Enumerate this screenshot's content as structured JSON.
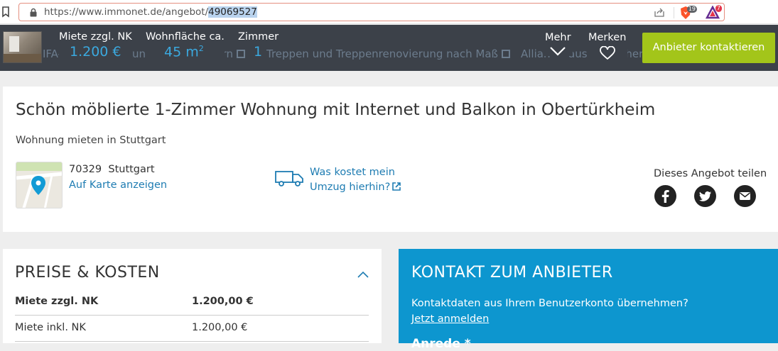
{
  "browser": {
    "url_prefix": "https://www.immonet.de/angebot/",
    "url_selected": "49069527",
    "brave_badge": "19",
    "rewards_badge": "7"
  },
  "sticky": {
    "ghost_items": [
      "IFA-B",
      "skunft or",
      "rdern",
      "Treppen und Treppenrenovierung nach Maß",
      "Allian",
      "ausrat",
      "icher"
    ],
    "miete_label": "Miete zzgl. NK",
    "miete_value": "1.200 €",
    "flaeche_label": "Wohnfläche ca.",
    "flaeche_value": "45 m",
    "flaeche_unit_sup": "2",
    "zimmer_label": "Zimmer",
    "zimmer_value": "1",
    "mehr_label": "Mehr",
    "merken_label": "Merken",
    "cta_label": "Anbieter kontaktieren"
  },
  "listing": {
    "title": "Schön möblierte 1-Zimmer Wohnung mit Internet und Balkon in Obertürkheim",
    "subtitle": "Wohnung mieten in Stuttgart",
    "postcode": "70329",
    "city": "Stuttgart",
    "map_link": "Auf Karte anzeigen",
    "move_line1": "Was kostet mein",
    "move_line2": "Umzug hierhin?",
    "share_label": "Dieses Angebot teilen"
  },
  "preise": {
    "title": "PREISE & KOSTEN",
    "rows": [
      {
        "label": "Miete zzgl. NK",
        "value": "1.200,00 €"
      },
      {
        "label": "Miete inkl. NK",
        "value": "1.200,00 €"
      }
    ]
  },
  "kontakt": {
    "title": "KONTAKT ZUM ANBIETER",
    "question": "Kontaktdaten aus Ihrem Benutzerkonto übernehmen?",
    "login_link": "Jetzt anmelden",
    "cut_text": "Anrede *"
  },
  "colors": {
    "header_bg": "#3c4149",
    "accent_blue": "#3ba9df",
    "cta_green": "#a3c51a",
    "kontakt_bg": "#0d96cf",
    "link": "#1e7cb2"
  }
}
